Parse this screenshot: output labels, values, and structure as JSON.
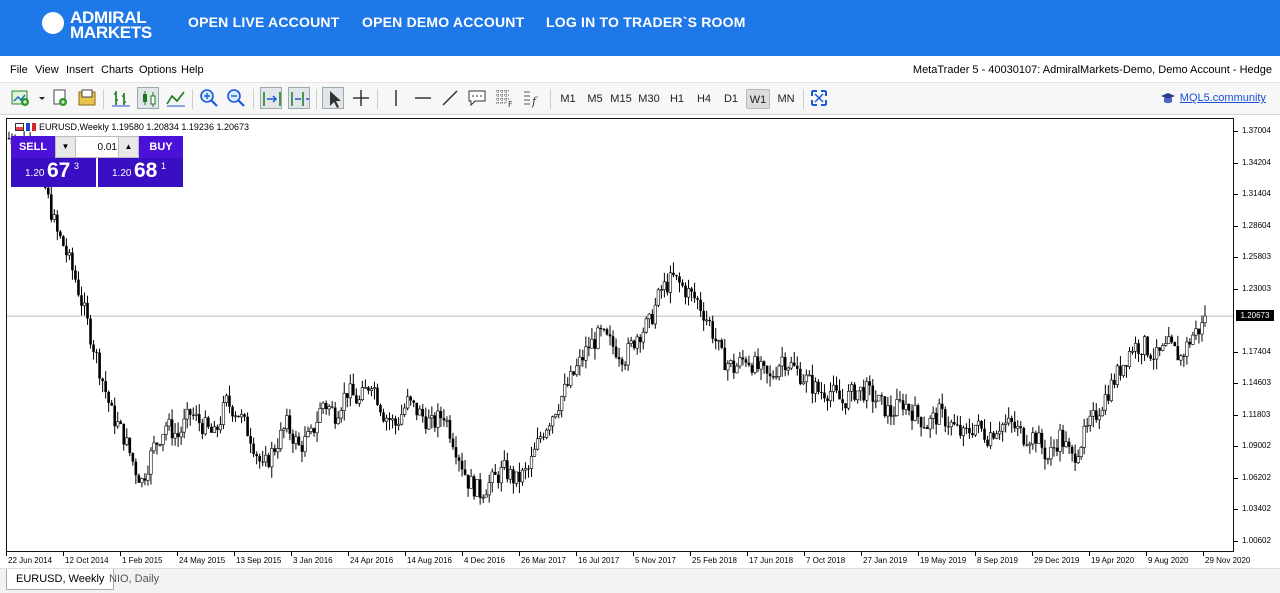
{
  "brand": {
    "line1": "ADMIRAL",
    "line2": "MARKETS"
  },
  "topnav": [
    "OPEN LIVE ACCOUNT",
    "OPEN DEMO ACCOUNT",
    "LOG IN TO TRADER`S ROOM"
  ],
  "menu": [
    "File",
    "View",
    "Insert",
    "Charts",
    "Options",
    "Help"
  ],
  "account": "MetaTrader 5 - 40030107: AdmiralMarkets-Demo, Demo Account - Hedge",
  "timeframes": [
    "M1",
    "M5",
    "M15",
    "M30",
    "H1",
    "H4",
    "D1",
    "W1",
    "MN"
  ],
  "active_timeframe": "W1",
  "mql_link": "MQL5.community",
  "chart_header": "EURUSD,Weekly  1.19580 1.20834 1.19236 1.20673",
  "trade": {
    "sell": "SELL",
    "buy": "BUY",
    "lot": "0.01",
    "sell_prefix": "1.20",
    "sell_big": "67",
    "sell_sup": "3",
    "buy_prefix": "1.20",
    "buy_big": "68",
    "buy_sup": "1"
  },
  "current_price": "1.20673",
  "tabs": [
    "EURUSD, Weekly",
    "NIO, Daily"
  ],
  "chart_data": {
    "type": "candlestick",
    "symbol": "EURUSD",
    "timeframe": "Weekly",
    "y_ticks": [
      "1.37004",
      "1.34204",
      "1.31404",
      "1.28604",
      "1.25803",
      "1.23003",
      "1.17404",
      "1.14603",
      "1.11803",
      "1.09002",
      "1.06202",
      "1.03402",
      "1.00602"
    ],
    "x_ticks": [
      "22 Jun 2014",
      "12 Oct 2014",
      "1 Feb 2015",
      "24 May 2015",
      "13 Sep 2015",
      "3 Jan 2016",
      "24 Apr 2016",
      "14 Aug 2016",
      "4 Dec 2016",
      "26 Mar 2017",
      "16 Jul 2017",
      "5 Nov 2017",
      "25 Feb 2018",
      "17 Jun 2018",
      "7 Oct 2018",
      "27 Jan 2019",
      "19 May 2019",
      "8 Sep 2019",
      "29 Dec 2019",
      "19 Apr 2020",
      "9 Aug 2020",
      "29 Nov 2020"
    ],
    "ylim": [
      0.996,
      1.382
    ],
    "current": 1.20673,
    "path": [
      [
        0,
        1.365
      ],
      [
        6,
        1.36
      ],
      [
        12,
        1.32
      ],
      [
        16,
        1.28
      ],
      [
        18,
        1.27
      ],
      [
        22,
        1.24
      ],
      [
        26,
        1.2
      ],
      [
        30,
        1.16
      ],
      [
        34,
        1.12
      ],
      [
        38,
        1.1
      ],
      [
        42,
        1.07
      ],
      [
        44,
        1.06
      ],
      [
        48,
        1.09
      ],
      [
        52,
        1.11
      ],
      [
        56,
        1.1
      ],
      [
        60,
        1.12
      ],
      [
        64,
        1.11
      ],
      [
        68,
        1.1
      ],
      [
        72,
        1.13
      ],
      [
        76,
        1.12
      ],
      [
        80,
        1.1
      ],
      [
        84,
        1.07
      ],
      [
        88,
        1.09
      ],
      [
        92,
        1.11
      ],
      [
        96,
        1.09
      ],
      [
        100,
        1.1
      ],
      [
        104,
        1.13
      ],
      [
        108,
        1.12
      ],
      [
        112,
        1.14
      ],
      [
        116,
        1.13
      ],
      [
        120,
        1.15
      ],
      [
        124,
        1.12
      ],
      [
        128,
        1.11
      ],
      [
        132,
        1.13
      ],
      [
        136,
        1.12
      ],
      [
        140,
        1.11
      ],
      [
        144,
        1.12
      ],
      [
        148,
        1.09
      ],
      [
        152,
        1.06
      ],
      [
        156,
        1.05
      ],
      [
        160,
        1.06
      ],
      [
        164,
        1.07
      ],
      [
        168,
        1.06
      ],
      [
        172,
        1.07
      ],
      [
        176,
        1.1
      ],
      [
        180,
        1.12
      ],
      [
        184,
        1.14
      ],
      [
        188,
        1.16
      ],
      [
        192,
        1.18
      ],
      [
        196,
        1.19
      ],
      [
        200,
        1.18
      ],
      [
        204,
        1.17
      ],
      [
        208,
        1.19
      ],
      [
        212,
        1.2
      ],
      [
        216,
        1.23
      ],
      [
        220,
        1.24
      ],
      [
        224,
        1.23
      ],
      [
        228,
        1.22
      ],
      [
        232,
        1.2
      ],
      [
        236,
        1.17
      ],
      [
        240,
        1.16
      ],
      [
        244,
        1.17
      ],
      [
        248,
        1.16
      ],
      [
        252,
        1.15
      ],
      [
        256,
        1.17
      ],
      [
        260,
        1.16
      ],
      [
        264,
        1.15
      ],
      [
        268,
        1.14
      ],
      [
        272,
        1.14
      ],
      [
        276,
        1.13
      ],
      [
        280,
        1.14
      ],
      [
        284,
        1.14
      ],
      [
        288,
        1.13
      ],
      [
        292,
        1.12
      ],
      [
        296,
        1.13
      ],
      [
        300,
        1.12
      ],
      [
        304,
        1.11
      ],
      [
        308,
        1.12
      ],
      [
        312,
        1.11
      ],
      [
        316,
        1.1
      ],
      [
        320,
        1.11
      ],
      [
        324,
        1.1
      ],
      [
        328,
        1.11
      ],
      [
        332,
        1.11
      ],
      [
        336,
        1.1
      ],
      [
        340,
        1.1
      ],
      [
        344,
        1.08
      ],
      [
        348,
        1.1
      ],
      [
        352,
        1.08
      ],
      [
        356,
        1.1
      ],
      [
        360,
        1.12
      ],
      [
        364,
        1.14
      ],
      [
        368,
        1.16
      ],
      [
        372,
        1.18
      ],
      [
        376,
        1.18
      ],
      [
        380,
        1.17
      ],
      [
        384,
        1.18
      ],
      [
        388,
        1.17
      ],
      [
        392,
        1.19
      ],
      [
        396,
        1.2
      ]
    ]
  }
}
